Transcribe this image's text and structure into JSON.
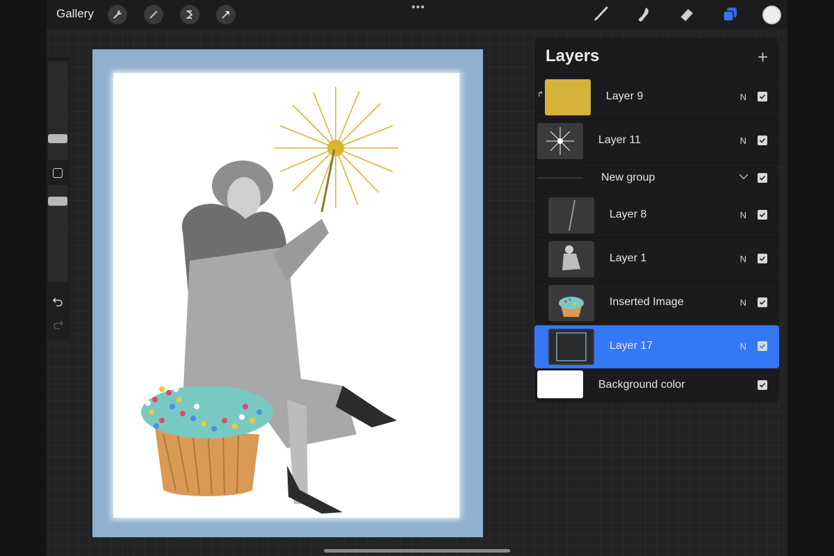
{
  "topbar": {
    "gallery_label": "Gallery",
    "tools_left": [
      "wrench-icon",
      "magic-wand-icon",
      "selection-icon",
      "transform-arrow-icon"
    ],
    "tools_right": [
      "brush-icon",
      "smudge-icon",
      "eraser-icon",
      "layers-icon"
    ],
    "accent": "#3478f6",
    "color_well": "#eeeeee"
  },
  "layers": {
    "title": "Layers",
    "add_symbol": "+",
    "items": [
      {
        "name": "Layer 9",
        "blend": "N",
        "visible": true
      },
      {
        "name": "Layer 11",
        "blend": "N",
        "visible": true
      },
      {
        "name": "New group",
        "blend": "",
        "visible": true
      },
      {
        "name": "Layer 8",
        "blend": "N",
        "visible": true
      },
      {
        "name": "Layer 1",
        "blend": "N",
        "visible": true
      },
      {
        "name": "Inserted Image",
        "blend": "N",
        "visible": true
      },
      {
        "name": "Layer 17",
        "blend": "N",
        "visible": true,
        "selected": true
      },
      {
        "name": "Background color",
        "blend": "",
        "visible": true
      }
    ]
  },
  "canvas": {
    "frame_color": "#8fb0cf",
    "paper_color": "#ffffff"
  }
}
